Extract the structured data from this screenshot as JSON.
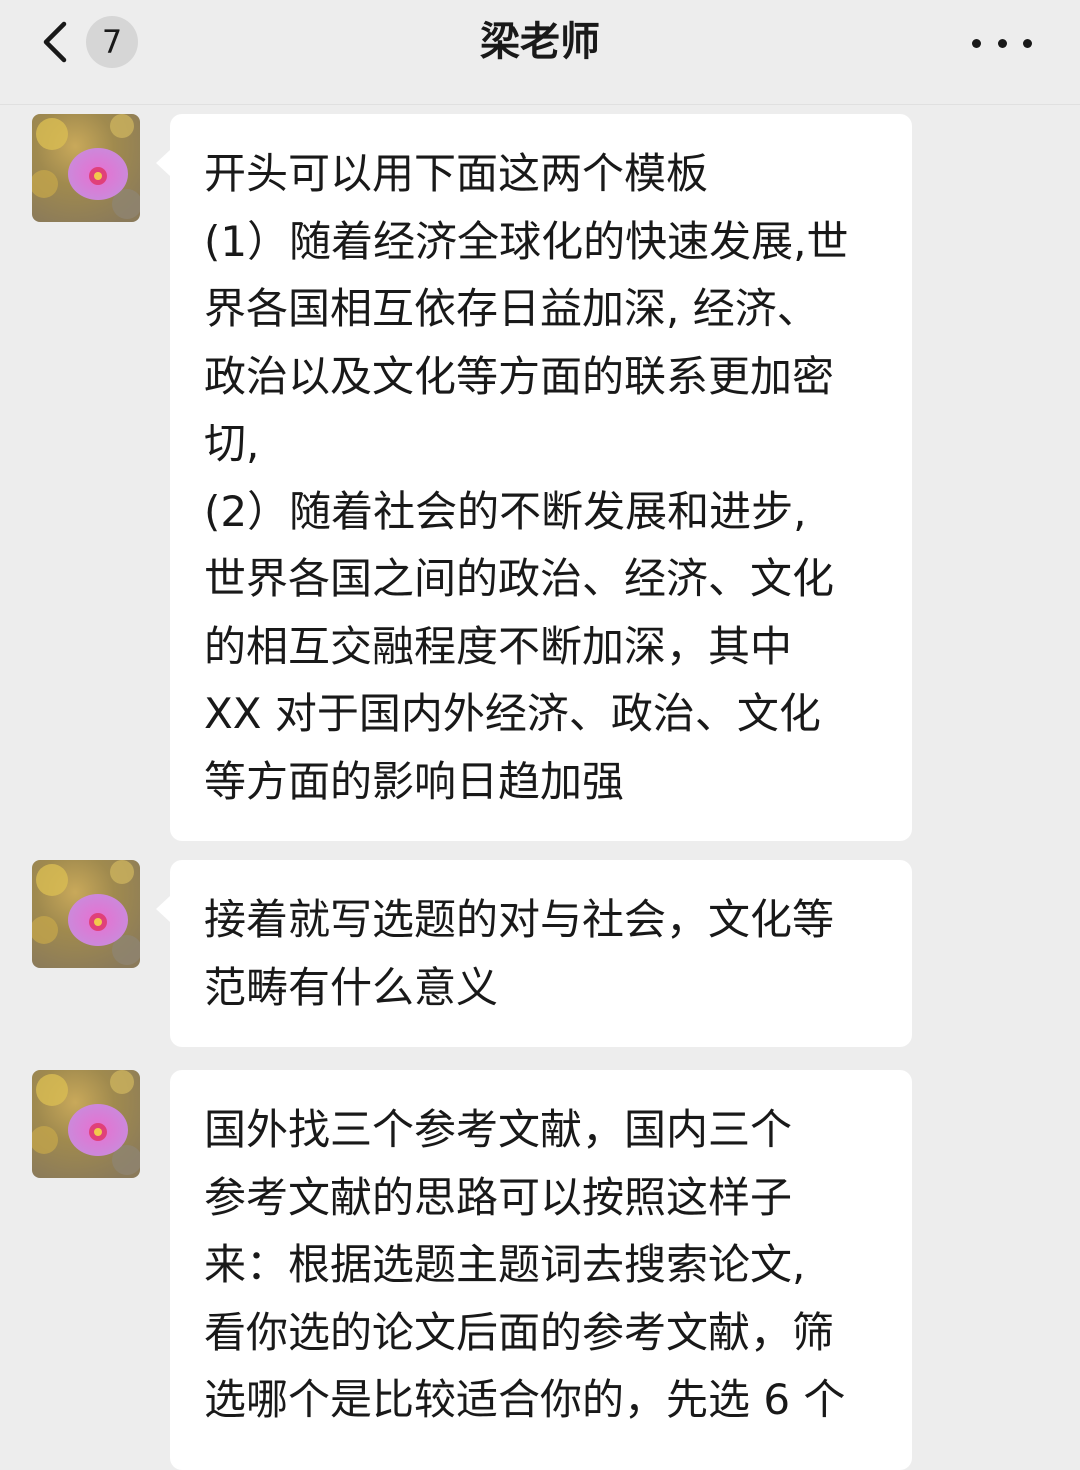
{
  "header": {
    "back_icon": "chevron-left-icon",
    "unread_count": "7",
    "title": "梁老师",
    "more_icon": "more-dots-icon"
  },
  "messages": [
    {
      "sender_avatar": "flower-avatar",
      "lines": [
        "开头可以用下面这两个模板",
        "(1）随着经济全球化的快速发展,世",
        "界各国相互依存日益加深, 经济、",
        "政治以及文化等方面的联系更加密",
        "切,",
        "(2）随着社会的不断发展和进步,",
        "世界各国之间的政治、经济、文化",
        "的相互交融程度不断加深，其中",
        "XX 对于国内外经济、政治、文化",
        "等方面的影响日趋加强"
      ]
    },
    {
      "sender_avatar": "flower-avatar",
      "lines": [
        "接着就写选题的对与社会，文化等",
        "范畴有什么意义"
      ]
    },
    {
      "sender_avatar": "flower-avatar",
      "lines": [
        "国外找三个参考文献，国内三个",
        "参考文献的思路可以按照这样子",
        "来：根据选题主题词去搜索论文,",
        "看你选的论文后面的参考文献，筛",
        "选哪个是比较适合你的，先选 6 个"
      ]
    }
  ],
  "colors": {
    "background": "#ededed",
    "bubble": "#ffffff",
    "text": "#191919",
    "badge": "#d6d6d6"
  }
}
